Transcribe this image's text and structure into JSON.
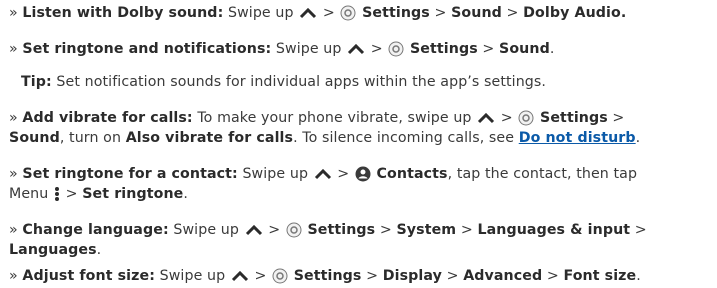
{
  "bullet": "»",
  "sep": ">",
  "items": [
    {
      "title": "Listen with Dolby sound:",
      "text_a": "Swipe up",
      "settings": "Settings",
      "path_1": "Sound",
      "path_2": "Dolby Audio."
    },
    {
      "title": "Set ringtone and notifications:",
      "text_a": "Swipe up",
      "settings": "Settings",
      "path_1": "Sound",
      "end": "."
    },
    {
      "tip_label": "Tip:",
      "tip_text": "Set notification sounds for individual apps within the app’s settings."
    },
    {
      "title": "Add vibrate for calls:",
      "text_a": "To make your phone vibrate, swipe up",
      "settings": "Settings",
      "path_1": "Sound",
      "text_b": ", turn on",
      "option": "Also vibrate for calls",
      "text_c": ". To silence incoming calls, see",
      "link": "Do not disturb",
      "end": "."
    },
    {
      "title": "Set ringtone for a contact:",
      "text_a": "Swipe up",
      "contacts": "Contacts",
      "text_b": ", tap the contact, then tap",
      "text_c": "Menu",
      "path_1": "Set ringtone",
      "end": "."
    },
    {
      "title": "Change language:",
      "text_a": "Swipe up",
      "settings": "Settings",
      "path_1": "System",
      "path_2": "Languages & input",
      "path_3": "Languages",
      "end": "."
    },
    {
      "title": "Adjust font size:",
      "text_a": "Swipe up",
      "settings": "Settings",
      "path_1": "Display",
      "path_2": "Advanced",
      "path_3": "Font size",
      "end": "."
    }
  ],
  "icons": {
    "swipe_up": "chevron-up-icon",
    "settings": "settings-gear-icon",
    "contacts": "contacts-icon",
    "menu": "menu-dots-icon"
  },
  "colors": {
    "text": "#3a3a3a",
    "link": "#0b5aa8",
    "icon": "#3a3a3a"
  }
}
